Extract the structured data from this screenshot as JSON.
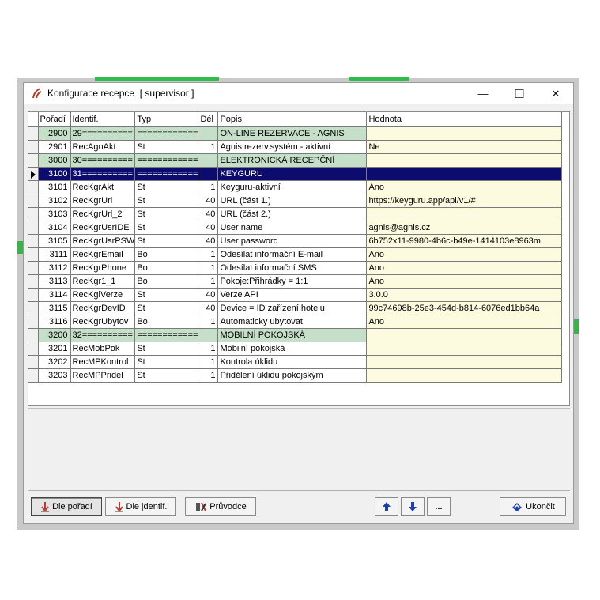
{
  "window": {
    "title": "Konfigurace recepce  [ supervisor ]",
    "minimize_glyph": "—",
    "maximize_glyph": "☐",
    "close_glyph": "✕"
  },
  "grid": {
    "columns": [
      "Pořadí",
      "Identif.",
      "Typ",
      "Dél",
      "Popis",
      "Hodnota"
    ],
    "rows": [
      {
        "order": "2900",
        "ident": "29==========",
        "type": "============",
        "len": "",
        "desc": "ON-LINE REZERVACE - AGNIS",
        "value": "",
        "group": true
      },
      {
        "order": "2901",
        "ident": "RecAgnAkt",
        "type": "St",
        "len": "1",
        "desc": "Agnis rezerv.systém - aktivní",
        "value": "Ne"
      },
      {
        "order": "3000",
        "ident": "30==========",
        "type": "============",
        "len": "",
        "desc": "ELEKTRONICKÁ RECEPČNÍ",
        "value": "",
        "group": true
      },
      {
        "order": "3100",
        "ident": "31==========",
        "type": "============",
        "len": "",
        "desc": "KEYGURU",
        "value": "",
        "group": true,
        "selected": true
      },
      {
        "order": "3101",
        "ident": "RecKgrAkt",
        "type": "St",
        "len": "1",
        "desc": "Keyguru-aktivní",
        "value": "Ano"
      },
      {
        "order": "3102",
        "ident": "RecKgrUrl",
        "type": "St",
        "len": "40",
        "desc": "URL (část 1.)",
        "value": "https://keyguru.app/api/v1/#"
      },
      {
        "order": "3103",
        "ident": "RecKgrUrl_2",
        "type": "St",
        "len": "40",
        "desc": "URL (část 2.)",
        "value": ""
      },
      {
        "order": "3104",
        "ident": "RecKgrUsrIDE",
        "type": "St",
        "len": "40",
        "desc": "User name",
        "value": "agnis@agnis.cz"
      },
      {
        "order": "3105",
        "ident": "RecKgrUsrPSW",
        "type": "St",
        "len": "40",
        "desc": "User password",
        "value": "6b752x11-9980-4b6c-b49e-1414103e8963m"
      },
      {
        "order": "3111",
        "ident": "RecKgrEmail",
        "type": "Bo",
        "len": "1",
        "desc": "Odesílat informační E-mail",
        "value": "Ano"
      },
      {
        "order": "3112",
        "ident": "RecKgrPhone",
        "type": "Bo",
        "len": "1",
        "desc": "Odesílat informační SMS",
        "value": "Ano"
      },
      {
        "order": "3113",
        "ident": "RecKgr1_1",
        "type": "Bo",
        "len": "1",
        "desc": "Pokoje:Přihrádky = 1:1",
        "value": "Ano"
      },
      {
        "order": "3114",
        "ident": "RecKgiVerze",
        "type": "St",
        "len": "40",
        "desc": "Verze API",
        "value": "3.0.0"
      },
      {
        "order": "3115",
        "ident": "RecKgrDevID",
        "type": "St",
        "len": "40",
        "desc": "Device = ID zařízení hotelu",
        "value": "99c74698b-25e3-454d-b814-6076ed1bb64a"
      },
      {
        "order": "3116",
        "ident": "RecKgrUbytov",
        "type": "Bo",
        "len": "1",
        "desc": "Automaticky ubytovat",
        "value": "Ano"
      },
      {
        "order": "3200",
        "ident": "32==========",
        "type": "============",
        "len": "",
        "desc": "MOBILNÍ POKOJSKÁ",
        "value": "",
        "group": true
      },
      {
        "order": "3201",
        "ident": "RecMobPok",
        "type": "St",
        "len": "1",
        "desc": "Mobilní pokojská",
        "value": ""
      },
      {
        "order": "3202",
        "ident": "RecMPKontrol",
        "type": "St",
        "len": "1",
        "desc": "Kontrola úklidu",
        "value": ""
      },
      {
        "order": "3203",
        "ident": "RecMPPridel",
        "type": "St",
        "len": "1",
        "desc": "Přidělení úklidu pokojským",
        "value": ""
      }
    ]
  },
  "buttons": {
    "sort_order": "Dle pořadí",
    "sort_ident": "Dle jdentif.",
    "wizard": "Průvodce",
    "up": "▲",
    "down": "▼",
    "more": "...",
    "exit": "Ukončit"
  },
  "colors": {
    "group_row": "#c6dfc9",
    "selected_row": "#0c0c6f",
    "value_cell": "#fdfbdf",
    "arrow_icon": "#1a3fb0",
    "sort_arrow": "#c0392b"
  }
}
